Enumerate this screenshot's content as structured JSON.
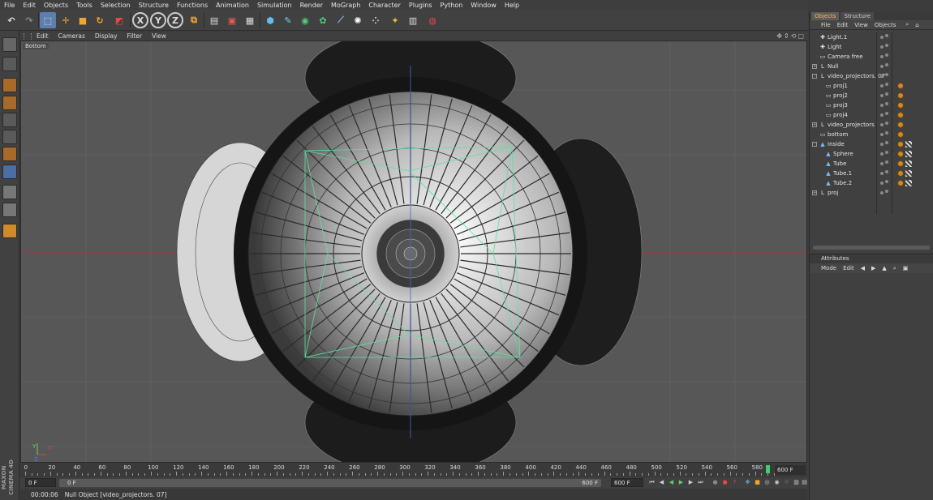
{
  "menubar": {
    "items": [
      "File",
      "Edit",
      "Objects",
      "Tools",
      "Selection",
      "Structure",
      "Functions",
      "Animation",
      "Simulation",
      "Render",
      "MoGraph",
      "Character",
      "Plugins",
      "Python",
      "Window",
      "Help"
    ]
  },
  "toolbar": {
    "axis_x": "X",
    "axis_y": "Y",
    "axis_z": "Z"
  },
  "viewport": {
    "menu": [
      "Edit",
      "Cameras",
      "Display",
      "Filter",
      "View"
    ],
    "camera_label": "Bottom",
    "axis_y": "Y",
    "axis_x": "X",
    "axis_z": "Z"
  },
  "timeline": {
    "ticks": [
      "0",
      "20",
      "40",
      "60",
      "80",
      "100",
      "120",
      "140",
      "160",
      "180",
      "200",
      "220",
      "240",
      "260",
      "280",
      "300",
      "320",
      "340",
      "360",
      "380",
      "400",
      "420",
      "440",
      "460",
      "480",
      "500",
      "520",
      "540",
      "560",
      "580"
    ],
    "end_field": "600 F"
  },
  "transport": {
    "current_frame": "0 F",
    "range_start": "0 F",
    "range_end": "600 F",
    "max_frame": "600 F"
  },
  "status": {
    "time": "00:00:06",
    "message": "Null Object [video_projectors. 07]"
  },
  "object_manager": {
    "tabs": [
      "Objects",
      "Structure"
    ],
    "menu": [
      "File",
      "Edit",
      "View",
      "Objects"
    ],
    "objects": [
      {
        "name": "Light.1",
        "indent": 0,
        "icon": "light-icon",
        "expand": ""
      },
      {
        "name": "Light",
        "indent": 0,
        "icon": "light-icon",
        "expand": ""
      },
      {
        "name": "Camera free",
        "indent": 0,
        "icon": "camera-icon",
        "expand": ""
      },
      {
        "name": "Null",
        "indent": 0,
        "icon": "null-icon",
        "expand": "+"
      },
      {
        "name": "video_projectors. 07",
        "indent": 0,
        "icon": "null-icon",
        "expand": "-"
      },
      {
        "name": "proj1",
        "indent": 1,
        "icon": "camera-icon",
        "expand": ""
      },
      {
        "name": "proj2",
        "indent": 1,
        "icon": "camera-icon",
        "expand": ""
      },
      {
        "name": "proj3",
        "indent": 1,
        "icon": "camera-icon",
        "expand": ""
      },
      {
        "name": "proj4",
        "indent": 1,
        "icon": "camera-icon",
        "expand": ""
      },
      {
        "name": "video_projectors",
        "indent": 0,
        "icon": "null-icon",
        "expand": "+"
      },
      {
        "name": "bottom",
        "indent": 0,
        "icon": "camera-icon",
        "expand": ""
      },
      {
        "name": "Inside",
        "indent": 0,
        "icon": "polygon-icon",
        "expand": "-"
      },
      {
        "name": "Sphere",
        "indent": 1,
        "icon": "polygon-icon",
        "expand": ""
      },
      {
        "name": "Tube",
        "indent": 1,
        "icon": "polygon-icon",
        "expand": ""
      },
      {
        "name": "Tube.1",
        "indent": 1,
        "icon": "polygon-icon",
        "expand": ""
      },
      {
        "name": "Tube.2",
        "indent": 1,
        "icon": "polygon-icon",
        "expand": ""
      },
      {
        "name": "proj",
        "indent": 0,
        "icon": "null-icon",
        "expand": "+"
      }
    ]
  },
  "attributes": {
    "title": "Attributes",
    "menu": [
      "Mode",
      "Edit"
    ]
  },
  "branding": {
    "logo_text": "MAXON CINEMA 4D"
  }
}
